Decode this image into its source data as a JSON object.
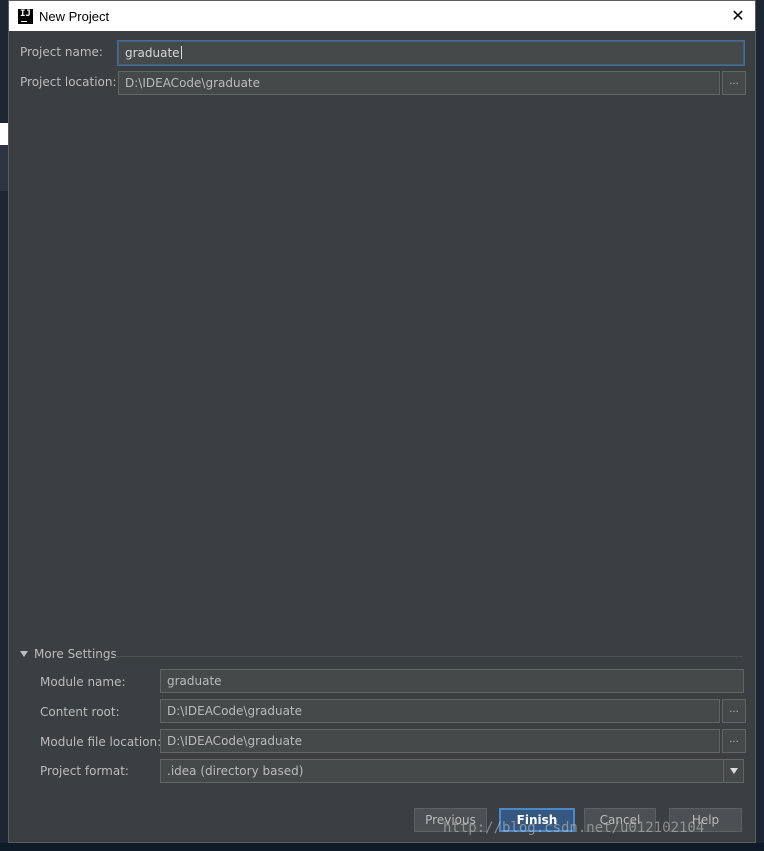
{
  "window": {
    "title": "New Project",
    "close_symbol": "✕",
    "app_icon": "intellij-icon",
    "app_icon_text": "IJ"
  },
  "project": {
    "name_label": "Project name:",
    "name_value": "graduate",
    "location_label": "Project location:",
    "location_value": "D:\\IDEACode\\graduate",
    "browse_label": "..."
  },
  "more_settings": {
    "toggle_label": "More Settings",
    "module_name_label": "Module name:",
    "module_name_value": "graduate",
    "content_root_label": "Content root:",
    "content_root_value": "D:\\IDEACode\\graduate",
    "module_file_label": "Module file location:",
    "module_file_value": "D:\\IDEACode\\graduate",
    "format_label": "Project format:",
    "format_value": ".idea (directory based)",
    "browse_label": "..."
  },
  "buttons": {
    "previous": "Previous",
    "finish": "Finish",
    "cancel": "Cancel",
    "help": "Help"
  },
  "watermark": "http://blog.csdn.net/u012102104",
  "colors": {
    "panel": "#3c3f41",
    "field": "#45494a",
    "text": "#bbbbbb",
    "focus": "#466d94",
    "primary_button": "#365880"
  }
}
